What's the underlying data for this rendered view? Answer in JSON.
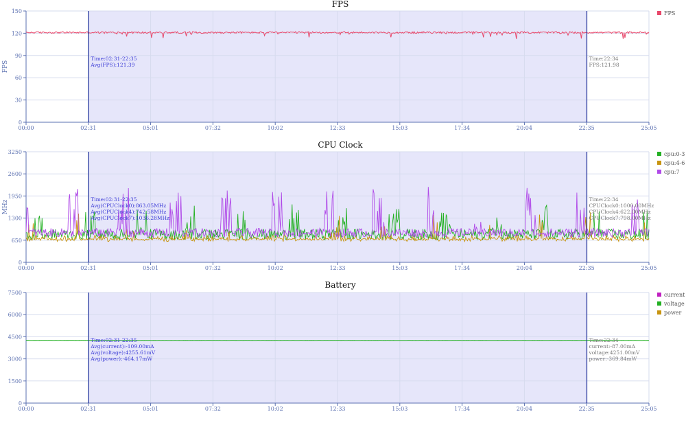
{
  "chart_data": [
    {
      "type": "line",
      "title": "FPS",
      "ylabel": "FPS",
      "ylim": [
        0,
        150
      ],
      "yticks": [
        "0",
        "30",
        "60",
        "90",
        "120",
        "150"
      ],
      "xticks": [
        "00:00",
        "02:31",
        "05:01",
        "07:32",
        "10:02",
        "12:33",
        "15:03",
        "17:34",
        "20:04",
        "22:35",
        "25:05"
      ],
      "x_range_minutes": [
        0,
        25.08
      ],
      "grid": true,
      "legend_position": "right",
      "selection": {
        "start_minute": 2.52,
        "end_minute": 22.58
      },
      "series": [
        {
          "name": "FPS",
          "color": "#e8476a",
          "base": 121,
          "noise": 1.2,
          "dip_prob": 0.05,
          "dip_depth": 8
        }
      ],
      "annotation_left": [
        "Time:02:31-22:35",
        "Avg(FPS):121.39"
      ],
      "annotation_right": [
        "Time:22:34",
        "FPS:121.98"
      ]
    },
    {
      "type": "line",
      "title": "CPU Clock",
      "ylabel": "MHz",
      "ylim": [
        0,
        3250
      ],
      "yticks": [
        "0",
        "650",
        "1300",
        "1950",
        "2600",
        "3250"
      ],
      "xticks": [
        "00:00",
        "02:31",
        "05:01",
        "07:32",
        "10:02",
        "12:33",
        "15:03",
        "17:34",
        "20:04",
        "22:35",
        "25:05"
      ],
      "x_range_minutes": [
        0,
        25.08
      ],
      "grid": true,
      "legend_position": "right",
      "selection": {
        "start_minute": 2.52,
        "end_minute": 22.58
      },
      "series": [
        {
          "name": "cpu:0-3",
          "color": "#22b022",
          "base": 820,
          "noise": 160,
          "dip_prob": 0.0,
          "dip_depth": 0
        },
        {
          "name": "cpu:4-6",
          "color": "#c89410",
          "base": 700,
          "noise": 90,
          "dip_prob": 0.0,
          "dip_depth": 0
        },
        {
          "name": "cpu:7",
          "color": "#b04ae8",
          "base": 870,
          "noise": 130,
          "dip_prob": 0.0,
          "dip_depth": 0
        }
      ],
      "annotation_left": [
        "Time:02:31-22:35",
        "Avg(CPUClock0):863.05MHz",
        "Avg(CPUClock4):742.58MHz",
        "Avg(CPUClock7):1036.28MHz"
      ],
      "annotation_right": [
        "Time:22:34",
        "CPUClock0:1000.00MHz",
        "CPUClock4:622.00MHz",
        "CPUClock7:798.00MHz"
      ]
    },
    {
      "type": "line",
      "title": "Battery",
      "ylabel": "",
      "ylim": [
        0,
        7500
      ],
      "yticks": [
        "0",
        "1500",
        "3000",
        "4500",
        "6000",
        "7500"
      ],
      "xticks": [
        "00:00",
        "02:31",
        "05:01",
        "07:32",
        "10:02",
        "12:33",
        "15:03",
        "17:34",
        "20:04",
        "22:35",
        "25:05"
      ],
      "x_range_minutes": [
        0,
        25.08
      ],
      "grid": true,
      "legend_position": "right",
      "selection": {
        "start_minute": 2.52,
        "end_minute": 22.58
      },
      "series": [
        {
          "name": "current",
          "color": "#c020c0",
          "base": null,
          "noise": 0,
          "dip_prob": 0,
          "dip_depth": 0
        },
        {
          "name": "voltage",
          "color": "#22b022",
          "base": 4255,
          "noise": 4,
          "dip_prob": 0,
          "dip_depth": 0
        },
        {
          "name": "power",
          "color": "#c89410",
          "base": null,
          "noise": 0,
          "dip_prob": 0,
          "dip_depth": 0
        }
      ],
      "annotation_left": [
        "Time:02:31-22:35",
        "Avg(current):-109.00mA",
        "Avg(voltage):4255.61mV",
        "Avg(power):-464.17mW"
      ],
      "annotation_right": [
        "Time:22:34",
        "current:-87.00mA",
        "voltage:4251.00mV",
        "power:-369.84mW"
      ]
    }
  ],
  "colors": {
    "axis": "#5a6fb0",
    "grid": "#d6dbee",
    "selection_fill": "#e6e6fa",
    "selection_line": "#1f2f9a",
    "annotation_left": "#3b3bd6",
    "annotation_right": "#777777",
    "title": "#111111"
  }
}
